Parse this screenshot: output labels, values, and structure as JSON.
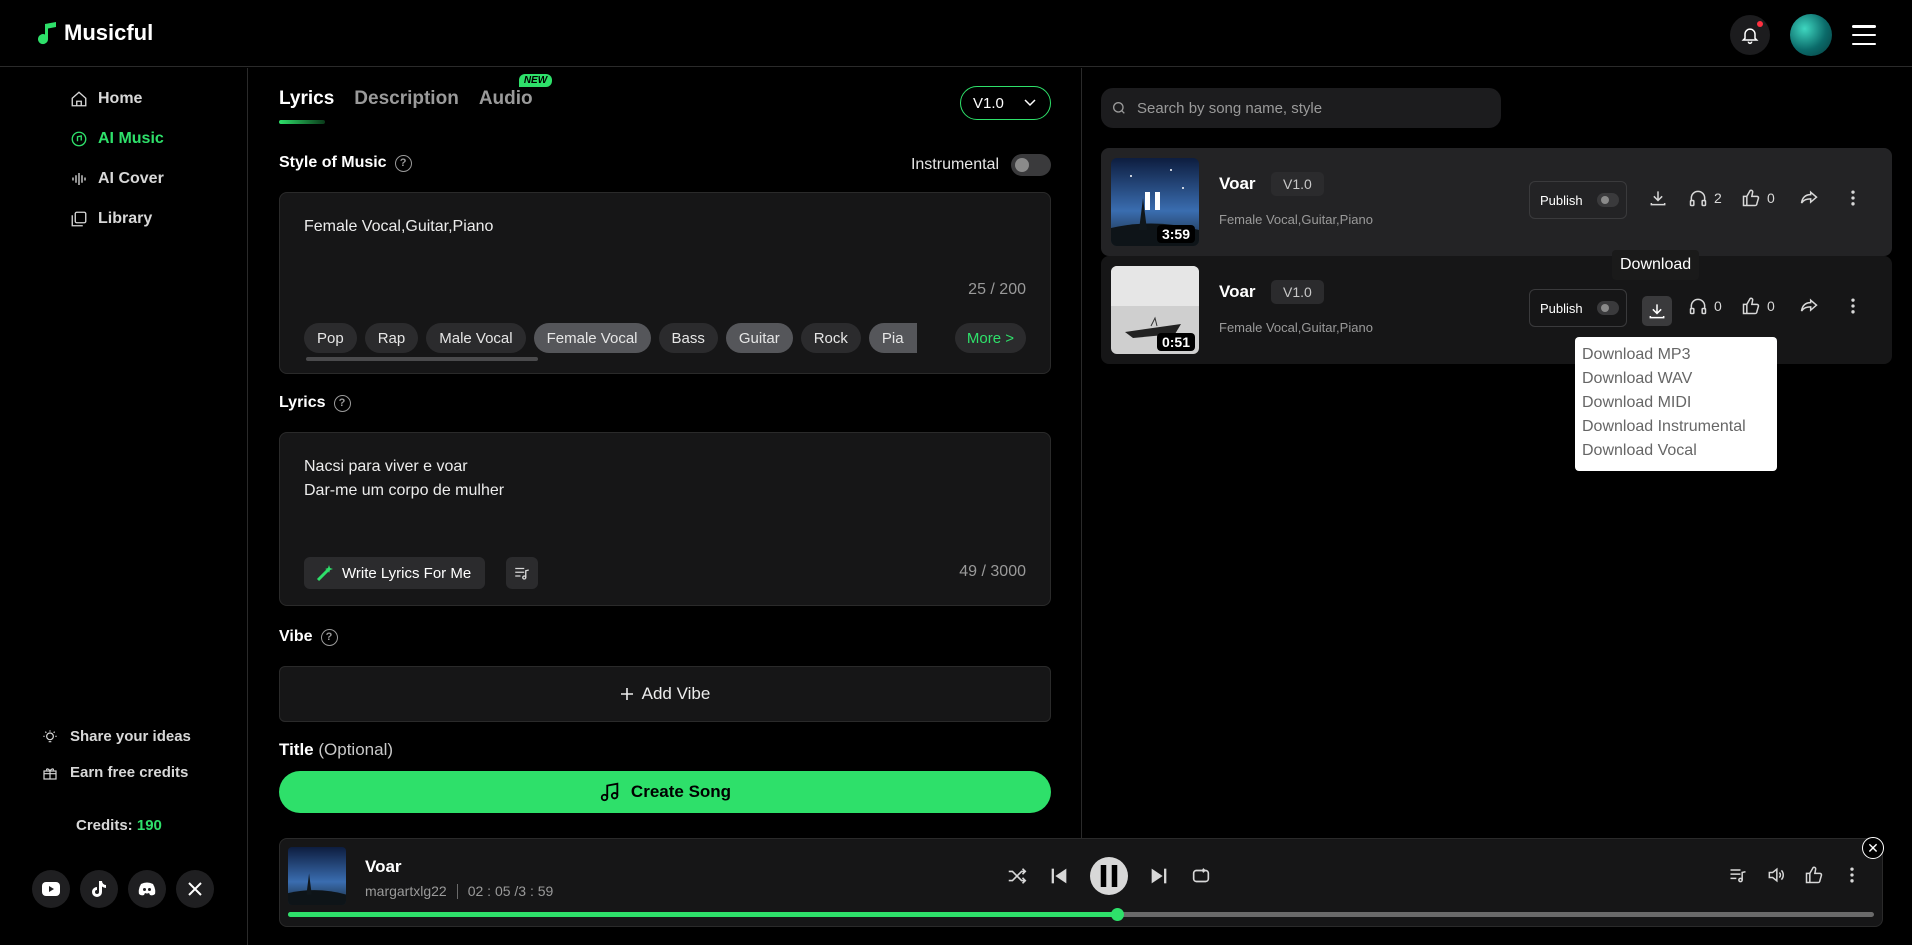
{
  "brand": {
    "name": "Musicful"
  },
  "sidebar": {
    "items": [
      {
        "label": "Home",
        "icon": "home-icon"
      },
      {
        "label": "AI Music",
        "icon": "ai-music-icon",
        "active": true
      },
      {
        "label": "AI Cover",
        "icon": "waveform-icon"
      },
      {
        "label": "Library",
        "icon": "library-icon"
      }
    ],
    "share_label": "Share your ideas",
    "earn_label": "Earn free credits",
    "credits_label": "Credits:",
    "credits_value": "190"
  },
  "tabs": {
    "lyrics": "Lyrics",
    "description": "Description",
    "audio": "Audio",
    "new_badge": "NEW"
  },
  "version_select": {
    "value": "V1.0"
  },
  "style_section": {
    "label": "Style of Music",
    "instrumental_label": "Instrumental",
    "value": "Female Vocal,Guitar,Piano",
    "counter": "25 / 200",
    "chips": [
      "Pop",
      "Rap",
      "Male Vocal",
      "Female Vocal",
      "Bass",
      "Guitar",
      "Rock",
      "Pia"
    ],
    "more_label": "More >"
  },
  "lyrics_section": {
    "label": "Lyrics",
    "line1": "Nacsi para viver e voar",
    "line2": "Dar-me um corpo de mulher",
    "write_label": "Write Lyrics For Me",
    "counter": "49 / 3000"
  },
  "vibe_section": {
    "label": "Vibe",
    "add_label": "Add Vibe"
  },
  "title_section": {
    "label": "Title",
    "optional": "(Optional)"
  },
  "create_button": {
    "label": "Create Song"
  },
  "search": {
    "placeholder": "Search by song name, style"
  },
  "songs": [
    {
      "title": "Voar",
      "version": "V1.0",
      "style": "Female Vocal,Guitar,Piano",
      "duration": "3:59",
      "publish": "Publish",
      "listens": "2",
      "likes": "0"
    },
    {
      "title": "Voar",
      "version": "V1.0",
      "style": "Female Vocal,Guitar,Piano",
      "duration": "0:51",
      "publish": "Publish",
      "listens": "0",
      "likes": "0"
    }
  ],
  "tooltip": {
    "text": "Download"
  },
  "download_menu": [
    "Download MP3",
    "Download WAV",
    "Download MIDI",
    "Download Instrumental",
    "Download Vocal"
  ],
  "player": {
    "title": "Voar",
    "user": "margartxlg22",
    "time": "02 : 05 /3 : 59",
    "progress": 0.523
  },
  "colors": {
    "accent": "#2ee06a",
    "background": "#000000",
    "panel": "#161617"
  }
}
